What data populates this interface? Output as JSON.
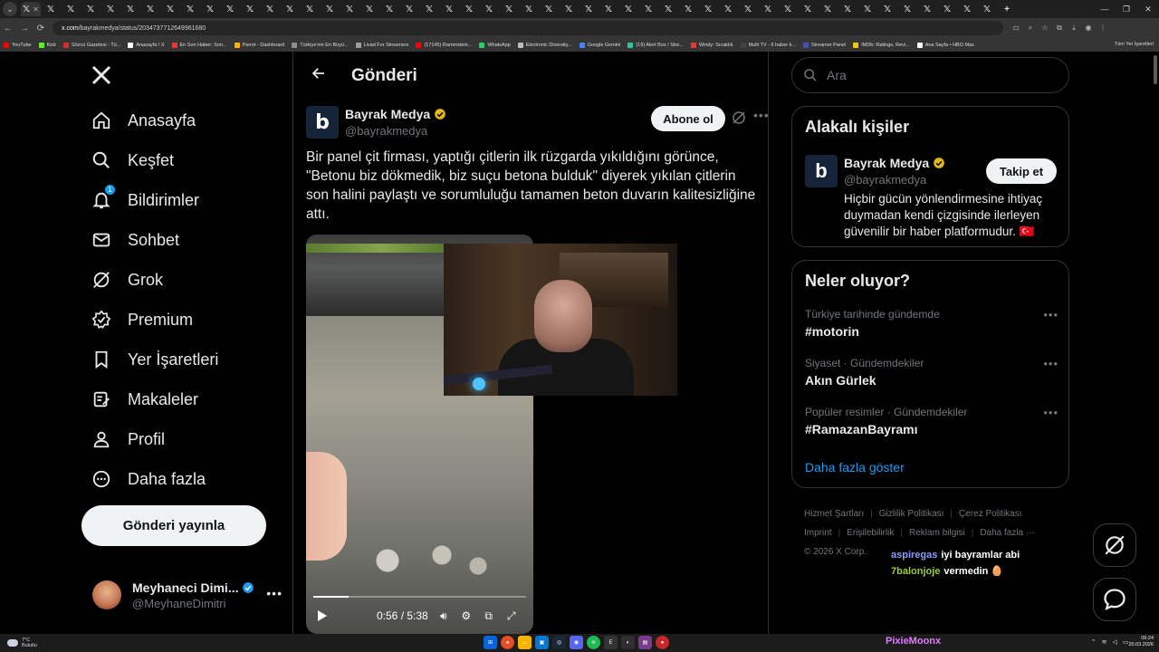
{
  "browser": {
    "url_host": "x.com",
    "url_path": "/bayrakmedya/status/2034737712649961680",
    "bookmarks": [
      {
        "label": "YouTube",
        "color": "#ff0000"
      },
      {
        "label": "Kick",
        "color": "#53fc18"
      },
      {
        "label": "Sözcü Gazetesi - Tü...",
        "color": "#d32f2f"
      },
      {
        "label": "Anasayfa / X",
        "color": "#ffffff"
      },
      {
        "label": "En Son Haber: Son...",
        "color": "#e53935"
      },
      {
        "label": "Parrot - Dashboard",
        "color": "#ffb300"
      },
      {
        "label": "Türkiye'nin En Büyü...",
        "color": "#8e8e8e"
      },
      {
        "label": "Livad For Streamers",
        "color": "#9e9e9e"
      },
      {
        "label": "(17145) Rammstein...",
        "color": "#ff0000"
      },
      {
        "label": "WhatsApp",
        "color": "#25d366"
      },
      {
        "label": "Electronic Diversity...",
        "color": "#bdbdbd"
      },
      {
        "label": "Google Gemini",
        "color": "#4285f4"
      },
      {
        "label": "(19) Alert Box / Stre...",
        "color": "#31c3a2"
      },
      {
        "label": "Windy: Sıcaklık",
        "color": "#e53935"
      },
      {
        "label": "Multi TV - 6 haber k...",
        "color": "#424242"
      },
      {
        "label": "Streamer Panel",
        "color": "#3f51b5"
      },
      {
        "label": "IMDb: Ratings, Revi...",
        "color": "#f5c518"
      },
      {
        "label": "Ana Sayfa • HBO Max",
        "color": "#ffffff"
      }
    ],
    "all_bookmarks": "Tüm Yer İşaretleri"
  },
  "nav": {
    "items": [
      {
        "label": "Anasayfa",
        "icon": "home-icon"
      },
      {
        "label": "Keşfet",
        "icon": "search-icon"
      },
      {
        "label": "Bildirimler",
        "icon": "bell-icon",
        "badge": "1"
      },
      {
        "label": "Sohbet",
        "icon": "mail-icon"
      },
      {
        "label": "Grok",
        "icon": "grok-icon"
      },
      {
        "label": "Premium",
        "icon": "premium-icon"
      },
      {
        "label": "Yer İşaretleri",
        "icon": "bookmark-icon"
      },
      {
        "label": "Makaleler",
        "icon": "article-icon"
      },
      {
        "label": "Profil",
        "icon": "person-icon"
      },
      {
        "label": "Daha fazla",
        "icon": "more-circle-icon"
      }
    ],
    "post_button": "Gönderi yayınla",
    "account": {
      "name": "Meyhaneci Dimi...",
      "handle": "@MeyhaneDimitri"
    }
  },
  "main": {
    "title": "Gönderi",
    "author": {
      "name": "Bayrak Medya",
      "handle": "@bayrakmedya",
      "avatar_letter": "b"
    },
    "subscribe": "Abone ol",
    "text": "Bir panel çit firması, yaptığı çitlerin ilk rüzgarda yıkıldığını görünce, \"Betonu biz dökmedik, biz suçu betona bulduk\" diyerek yıkılan çitlerin son halini paylaştı ve sorumluluğu tamamen beton duvarın kalitesizliğine attı.",
    "video": {
      "time": "0:56 / 5:38",
      "progress": 0.166
    }
  },
  "right": {
    "search_placeholder": "Ara",
    "related": {
      "title": "Alakalı kişiler",
      "name": "Bayrak Medya",
      "handle": "@bayrakmedya",
      "follow": "Takip et",
      "bio": "Hiçbir gücün yönlendirmesine ihtiyaç duymadan kendi çizgisinde ilerleyen güvenilir bir haber platformudur. 🇹🇷"
    },
    "trends": {
      "title": "Neler oluyor?",
      "items": [
        {
          "category": "Türkiye tarihinde gündemde",
          "name": "#motorin"
        },
        {
          "category": "Siyaset · Gündemdekiler",
          "name": "Akın Gürlek"
        },
        {
          "category": "Popüler resimler · Gündemdekiler",
          "name": "#RamazanBayramı"
        }
      ],
      "show_more": "Daha fazla göster"
    },
    "footer": [
      "Hizmet Şartları",
      "Gizlilik Politikası",
      "Çerez Politikası",
      "Imprint",
      "Erişilebilirlik",
      "Reklam bilgisi",
      "Daha fazla ···",
      "© 2026 X Corp."
    ]
  },
  "chat": [
    {
      "user": "aspiregas",
      "message": "iyi bayramlar abi"
    },
    {
      "user": "7balonjoje",
      "message": "vermedin 🥚"
    }
  ],
  "taskbar": {
    "weather_temp": "7°C",
    "weather_desc": "Bulutlu",
    "overlay_name": "PixieMoonx",
    "time": "09:24",
    "date": "20.03.2026"
  }
}
